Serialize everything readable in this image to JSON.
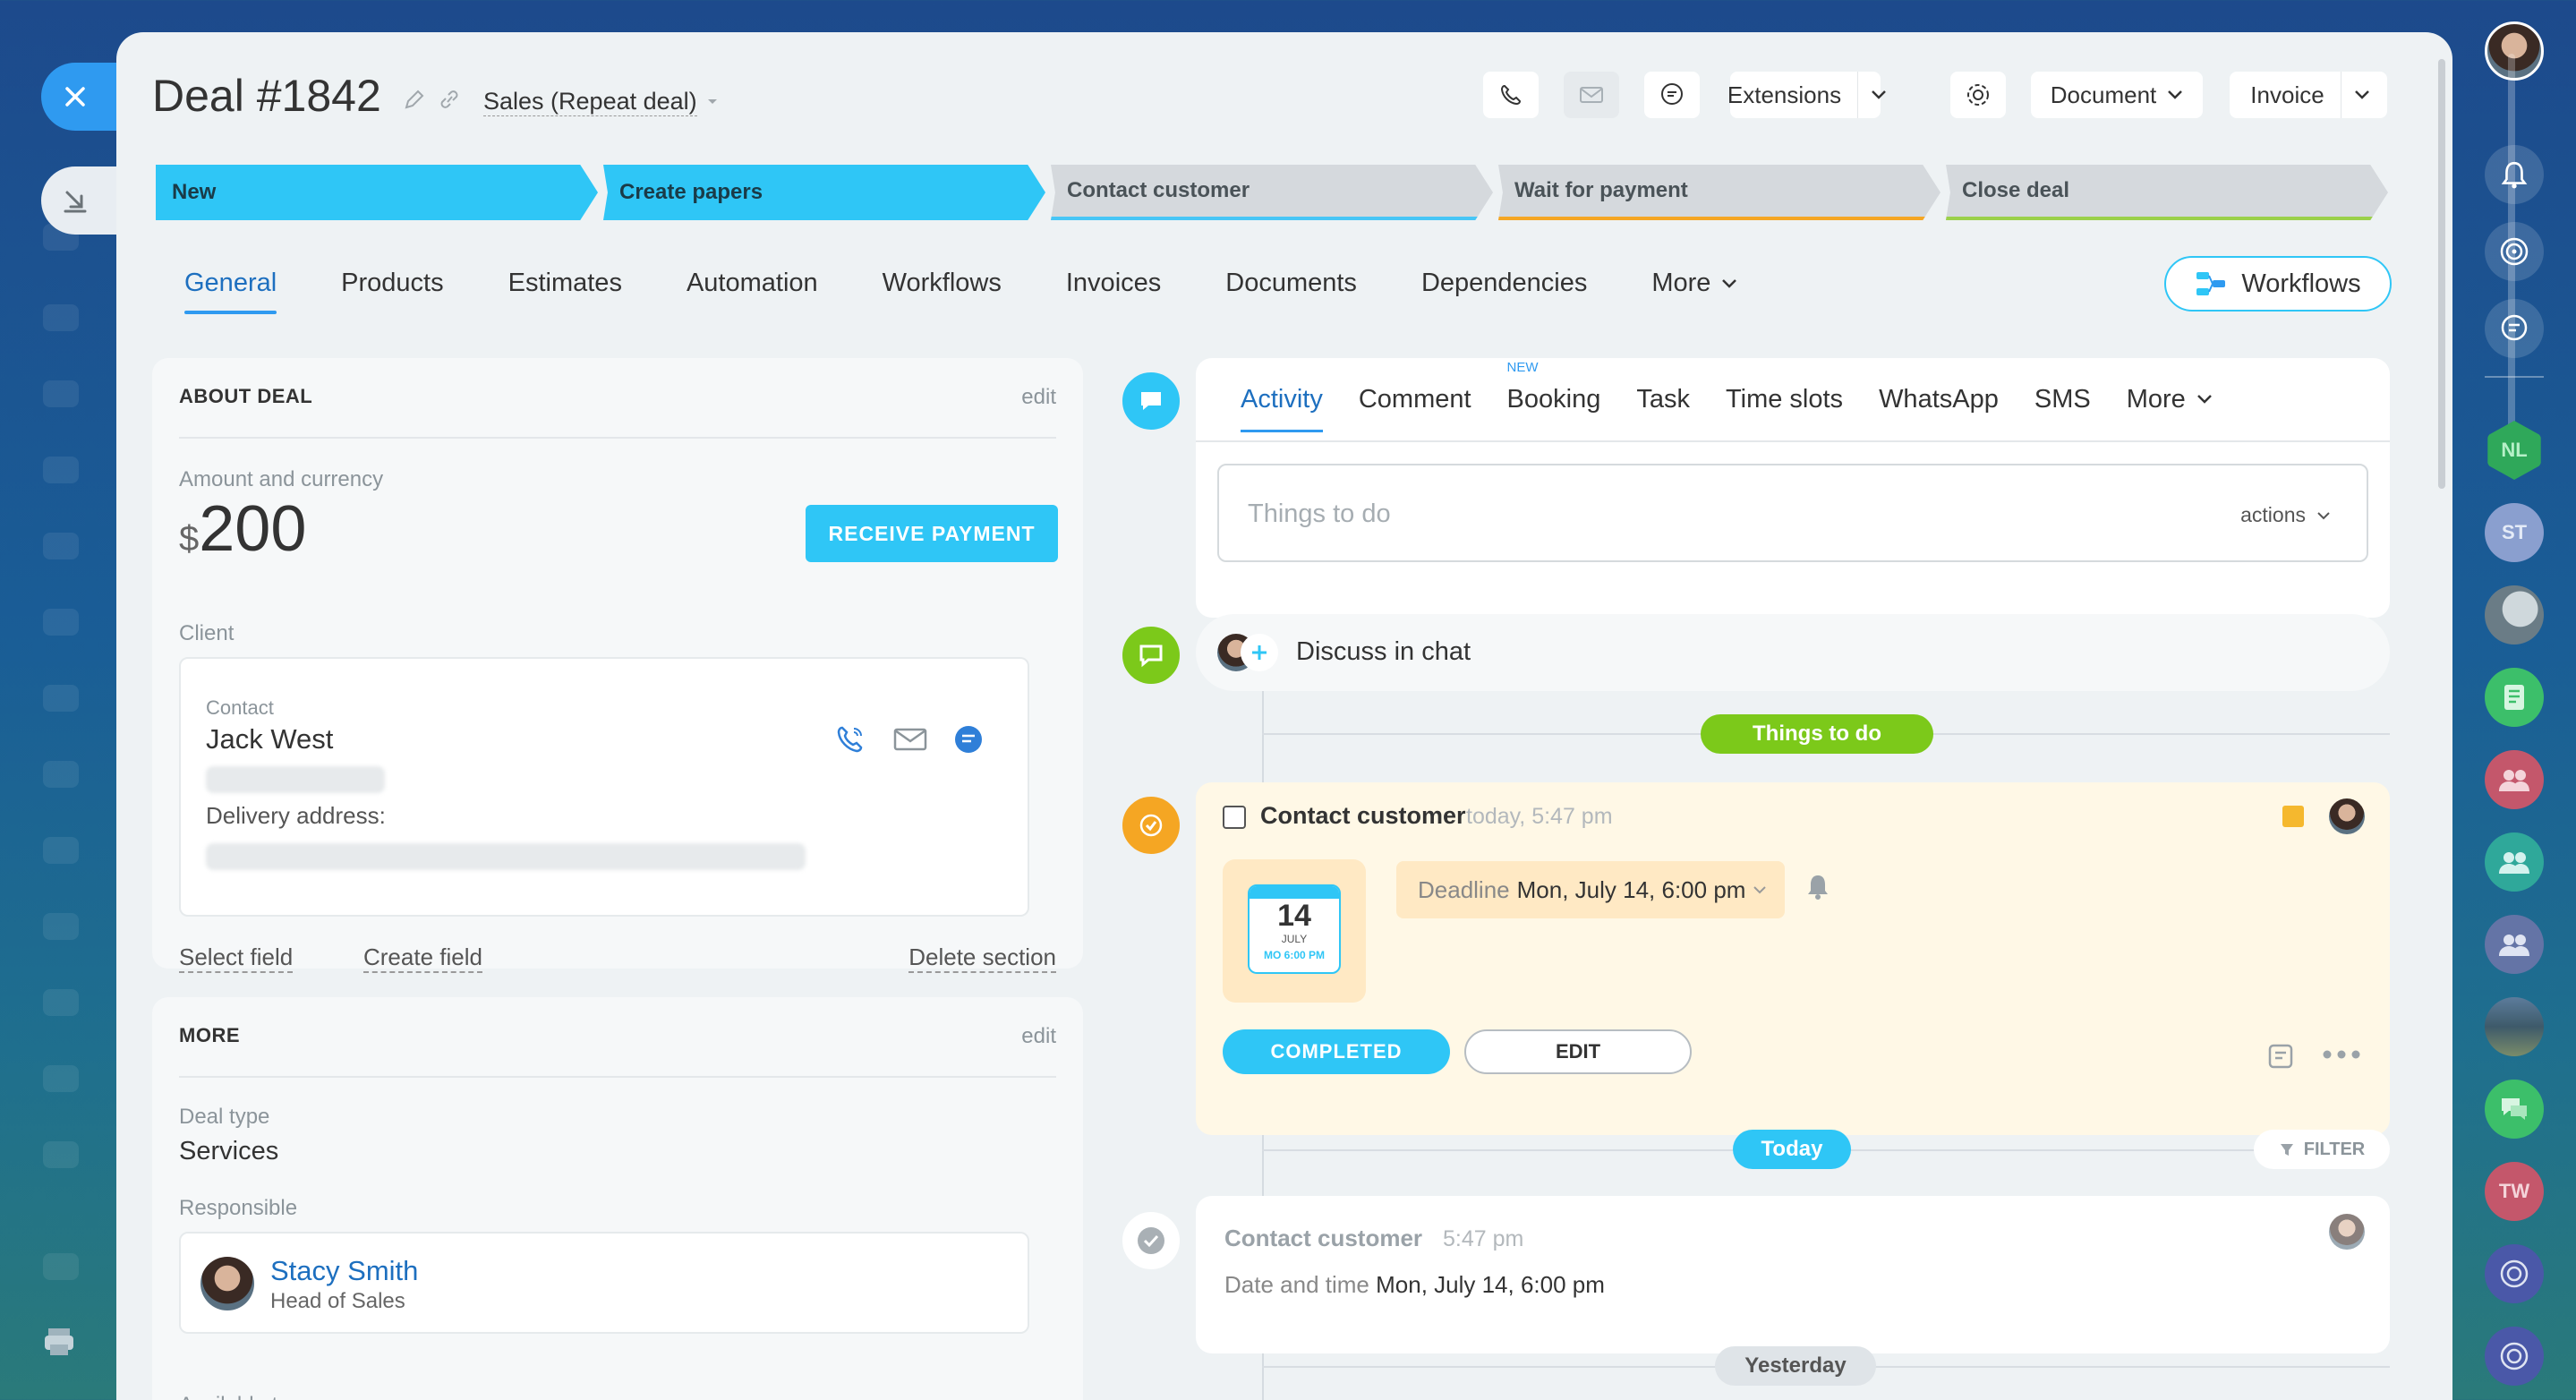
{
  "deal": {
    "title": "Deal #1842",
    "pipeline": "Sales (Repeat deal)"
  },
  "header_buttons": {
    "extensions": "Extensions",
    "document": "Document",
    "invoice": "Invoice"
  },
  "stages": [
    {
      "label": "New",
      "state": "active",
      "color": "#2fc6f6"
    },
    {
      "label": "Create papers",
      "state": "active",
      "color": "#2fc6f6"
    },
    {
      "label": "Contact customer",
      "state": "inactive",
      "color": "#47c6f6"
    },
    {
      "label": "Wait for payment",
      "state": "inactive",
      "color": "#f5a623"
    },
    {
      "label": "Close deal",
      "state": "inactive",
      "color": "#9bd14a"
    }
  ],
  "tabs": [
    "General",
    "Products",
    "Estimates",
    "Automation",
    "Workflows",
    "Invoices",
    "Documents",
    "Dependencies",
    "More"
  ],
  "workflows_button": "Workflows",
  "about": {
    "section_title": "ABOUT DEAL",
    "edit": "edit",
    "amount_label": "Amount and currency",
    "currency_symbol": "$",
    "amount": "200",
    "receive_payment": "RECEIVE PAYMENT",
    "client_label": "Client",
    "contact_label": "Contact",
    "contact_name": "Jack West",
    "delivery_label": "Delivery address:",
    "select_field": "Select field",
    "create_field": "Create field",
    "delete_section": "Delete section"
  },
  "more_section": {
    "section_title": "MORE",
    "edit": "edit",
    "deal_type_label": "Deal type",
    "deal_type": "Services",
    "responsible_label": "Responsible",
    "responsible_name": "Stacy Smith",
    "responsible_role": "Head of Sales",
    "available_label": "Available to everyone"
  },
  "activity": {
    "tabs": [
      "Activity",
      "Comment",
      "Booking",
      "Task",
      "Time slots",
      "WhatsApp",
      "SMS",
      "More"
    ],
    "new_badge": "NEW",
    "placeholder": "Things to do",
    "actions": "actions"
  },
  "discuss": "Discuss in chat",
  "things_to_do_pill": "Things to do",
  "todo": {
    "title": "Contact customer",
    "time": "today, 5:47 pm",
    "cal_day": "14",
    "cal_month": "JULY",
    "cal_time": "MO 6:00 PM",
    "deadline_label": "Deadline",
    "deadline_value": "Mon, July 14, 6:00 pm",
    "completed": "COMPLETED",
    "edit": "EDIT"
  },
  "today_pill": "Today",
  "filter": "FILTER",
  "history": {
    "title": "Contact customer",
    "time": "5:47 pm",
    "dt_label": "Date and time",
    "dt_value": "Mon, July 14, 6:00 pm"
  },
  "yesterday_pill": "Yesterday",
  "right_rail": {
    "nl": "NL",
    "st": "ST",
    "tw": "TW"
  },
  "colors": {
    "accent": "#2fc6f6",
    "link": "#1d6fbf",
    "todo_bg": "#fff8e6",
    "green_pill": "#7cc91a",
    "orange_dot": "#f5a623"
  }
}
